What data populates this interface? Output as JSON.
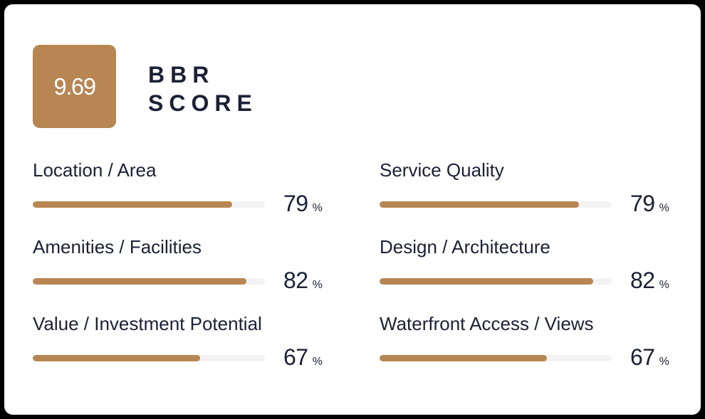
{
  "header": {
    "score": "9.69",
    "title_line1": "BBR",
    "title_line2": "SCORE"
  },
  "colors": {
    "accent": "#b78652",
    "track": "#f3f3f3",
    "text": "#1c2035"
  },
  "metrics": [
    {
      "label": "Location / Area",
      "value": "79",
      "unit": "%",
      "percent": 86
    },
    {
      "label": "Service Quality",
      "value": "79",
      "unit": "%",
      "percent": 86
    },
    {
      "label": "Amenities / Facilities",
      "value": "82",
      "unit": "%",
      "percent": 92
    },
    {
      "label": "Design / Architecture",
      "value": "82",
      "unit": "%",
      "percent": 92
    },
    {
      "label": "Value / Investment Potential",
      "value": "67",
      "unit": "%",
      "percent": 72
    },
    {
      "label": "Waterfront Access / Views",
      "value": "67",
      "unit": "%",
      "percent": 72
    }
  ]
}
